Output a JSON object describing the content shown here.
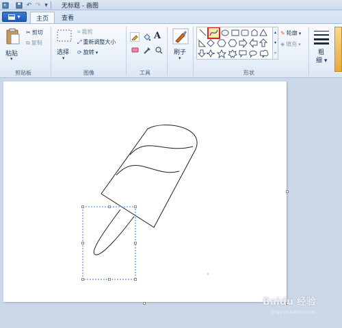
{
  "window": {
    "title": "无标题 - 画图"
  },
  "quick_access": {
    "items": [
      "paint-icon",
      "save-icon",
      "undo-icon",
      "redo-icon",
      "customize-icon"
    ]
  },
  "tabs": {
    "file_label": "▾",
    "home": "主页",
    "view": "查看"
  },
  "clipboard": {
    "paste": "粘贴",
    "cut": "剪切",
    "copy": "复制",
    "group": "剪贴板"
  },
  "image": {
    "select": "选择",
    "crop": "裁剪",
    "resize": "重新调整大小",
    "rotate": "旋转",
    "group": "图像"
  },
  "tools": {
    "group": "工具",
    "text_glyph": "A"
  },
  "brushes": {
    "label": "刷子"
  },
  "shapes": {
    "outline": "轮廓",
    "fill": "填充",
    "group": "形状",
    "selected": "curve"
  },
  "size": {
    "label_line1": "粗",
    "label_line2": "细"
  },
  "colors": {
    "accent": "#1d5cb4",
    "selection": "#d0262a"
  },
  "watermark": {
    "text": "Baidu 经验",
    "sub": "jingyan.baidu.com"
  }
}
